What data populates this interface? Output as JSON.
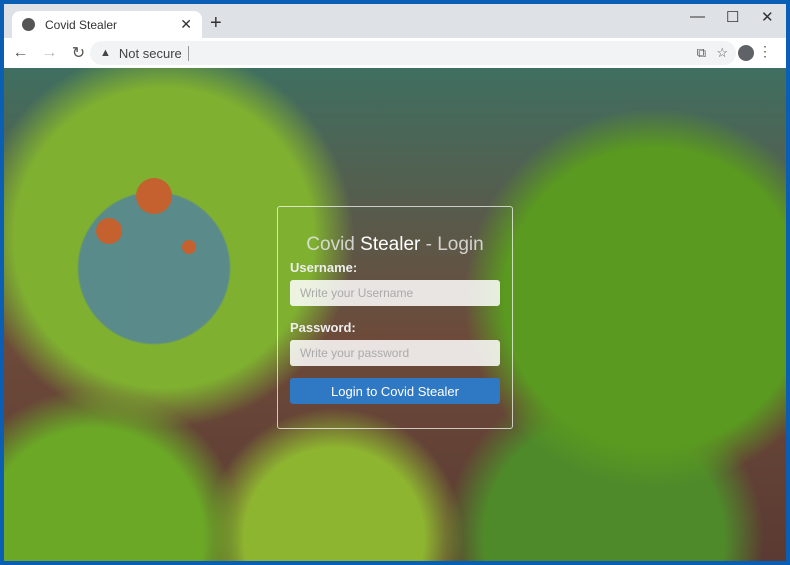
{
  "browser": {
    "tab_title": "Covid Stealer",
    "security_label": "Not secure"
  },
  "login": {
    "title_prefix": "Covid ",
    "title_strong": "Stealer",
    "title_suffix": " - Login",
    "username_label": "Username:",
    "username_placeholder": "Write your Username",
    "password_label": "Password:",
    "password_placeholder": "Write your password",
    "submit_label": "Login to Covid Stealer"
  },
  "colors": {
    "button": "#2f78c4",
    "frame": "#0a5fb4"
  }
}
